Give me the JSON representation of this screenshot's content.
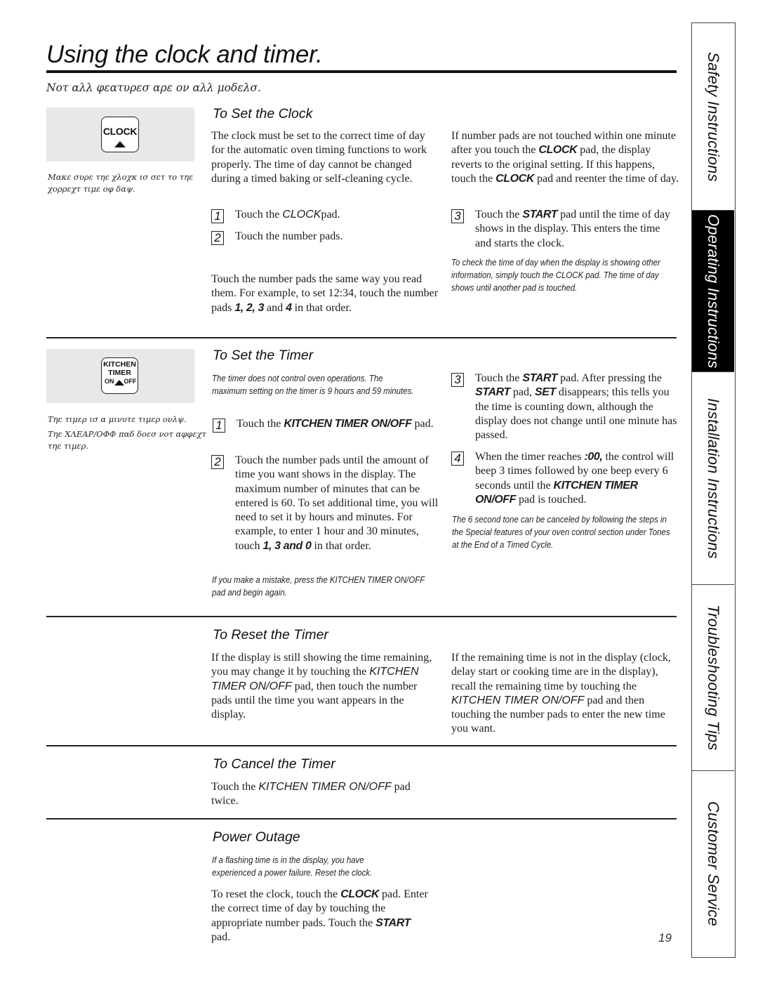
{
  "page": {
    "title": "Using the clock and timer.",
    "subnote": "Νοτ αλλ φεατυρεσ αρε ον αλλ μοδελσ.",
    "page_number": "19"
  },
  "side_tabs": [
    {
      "label": "Safety Instructions",
      "active": false
    },
    {
      "label": "Operating Instructions",
      "active": true
    },
    {
      "label": "Installation Instructions",
      "active": false
    },
    {
      "label": "Troubleshooting Tips",
      "active": false
    },
    {
      "label": "Customer Service",
      "active": false
    }
  ],
  "clock_section": {
    "heading": "To Set the Clock",
    "pad_icon": {
      "label": "CLOCK",
      "icon": "clock-pad-icon"
    },
    "side_note": "Μακε συρε τηε χλοχκ ισ σετ το τηε χορρεχτ τιμε οφ δαψ.",
    "intro": "The clock must be set to the correct time of day for the automatic oven timing functions to work properly. The time of day cannot be changed during a timed baking or self-cleaning cycle.",
    "steps": [
      {
        "num": "1",
        "pre": "Touch the ",
        "key": "CLOCK",
        "post": "pad."
      },
      {
        "num": "2",
        "pre": "Touch the number pads.",
        "key": "",
        "post": ""
      },
      {
        "num": "3",
        "pre": "Touch the ",
        "key": "START",
        "post": " pad until the time of day shows in the display. This enters the time and starts the clock."
      }
    ],
    "example": {
      "pre": "Touch the number pads the same way you read them. For example, to set 12:34, touch the number pads ",
      "keys": "1, 2, 3",
      "mid": " and ",
      "key2": "4",
      "post": " in that order."
    },
    "right_para": {
      "pre": "If number pads are not touched within one minute after you touch the ",
      "key": "CLOCK",
      "mid": " pad, the display reverts to the original setting. If this happens, touch the ",
      "key2": "CLOCK",
      "post": " pad and reenter the time of day."
    },
    "note": "To check the time of day when the display is showing other information, simply touch the CLOCK pad. The time of day shows until another pad is touched."
  },
  "timer_section": {
    "heading": "To Set the Timer",
    "pad_icon": {
      "line1": "KITCHEN",
      "line2": "TIMER",
      "on": "ON",
      "off": "OFF",
      "icon": "kitchen-timer-pad-icon"
    },
    "side_note_1": "Τηε τιμερ ισ α μινυτε τιμερ ονλψ.",
    "side_note_2": "Τηε ΧΛΕΑΡ/ΟΦΦ παδ δοεσ νοτ αφφεχτ τηε τιμερ.",
    "intro_note": "The timer does not control oven operations. The maximum setting on the timer is 9 hours and 59 minutes.",
    "steps": [
      {
        "num": "1",
        "pre": "Touch the ",
        "key": "KITCHEN TIMER ON/OFF",
        "post": " pad."
      },
      {
        "num": "2",
        "pre": "Touch the number pads until the amount of time you want shows in the display. The maximum number of minutes that can be entered is 60. To set additional time, you will need to set it by hours and minutes. For example, to enter 1 hour and 30 minutes, touch ",
        "key": "1, 3 and 0",
        "post": " in that order."
      },
      {
        "num": "3",
        "pre": "Touch the ",
        "key": "START",
        "mid": " pad. After pressing the ",
        "key2": "START",
        "mid2": " pad, ",
        "key3": "SET",
        "post": " disappears; this tells you the time is counting down, although the display does not change until one minute has passed."
      },
      {
        "num": "4",
        "pre": "When the timer reaches ",
        "key": ":00,",
        "mid": " the control will beep 3 times followed by one beep every 6 seconds until the ",
        "key2": "KITCHEN TIMER ON/OFF",
        "post": " pad is touched."
      }
    ],
    "mistake_note": "If you make a mistake, press the KITCHEN TIMER ON/OFF pad and begin again.",
    "tone_note": "The 6 second tone can be canceled by following the steps in the Special features of your oven control section under Tones at the End of a Timed Cycle."
  },
  "reset_section": {
    "heading": "To Reset the Timer",
    "left": {
      "pre": "If the display is still showing the time remaining, you may change it by touching the ",
      "key": "KITCHEN TIMER ON/OFF",
      "post": " pad, then touch the number pads until the time you want appears in the display."
    },
    "right": {
      "pre": "If the remaining time is not in the display (clock, delay start or cooking time are in the display), recall the remaining time by touching the ",
      "key": "KITCHEN TIMER ON/OFF",
      "post": " pad and then touching the number pads to enter the new time you want."
    }
  },
  "cancel_section": {
    "heading": "To Cancel the Timer",
    "pre": "Touch the ",
    "key": "KITCHEN TIMER ON/OFF",
    "post": " pad twice."
  },
  "power_section": {
    "heading": "Power Outage",
    "note": "If a flashing time is in the display, you have experienced a power failure. Reset the clock.",
    "pre": "To reset the clock, touch the ",
    "key": "CLOCK",
    "mid": " pad. Enter the correct time of day by touching the appropriate number pads. Touch the ",
    "key2": "START",
    "post": " pad."
  }
}
